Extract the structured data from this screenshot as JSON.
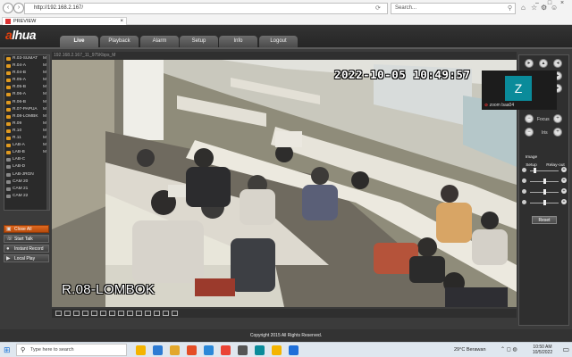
{
  "browser": {
    "address": "http://192.168.2.167/",
    "search_placeholder": "Search...",
    "tab_title": "PREVIEW",
    "tab_close": "×",
    "back_glyph": "‹",
    "forward_glyph": "›",
    "window_controls": [
      "–",
      "□",
      "×"
    ],
    "toolbar_icons": [
      "home-icon",
      "star-icon",
      "gear-icon",
      "smiley-icon"
    ]
  },
  "app": {
    "logo_prefix": "a",
    "logo_rest": "lhua",
    "nav": [
      {
        "label": "Live",
        "active": true
      },
      {
        "label": "Playback",
        "active": false
      },
      {
        "label": "Alarm",
        "active": false
      },
      {
        "label": "Setup",
        "active": false
      },
      {
        "label": "Info",
        "active": false
      },
      {
        "label": "Logout",
        "active": false
      }
    ],
    "copyright": "Copyright 2015 All Rights Reserved."
  },
  "channels": [
    {
      "label": "R.03-SUMAT",
      "m": "M",
      "active": true
    },
    {
      "label": "R.04-A",
      "m": "M",
      "active": true
    },
    {
      "label": "R.04-B",
      "m": "M",
      "active": true
    },
    {
      "label": "R.05-A",
      "m": "M",
      "active": true
    },
    {
      "label": "R.05-B",
      "m": "M",
      "active": true
    },
    {
      "label": "R.06-A",
      "m": "M",
      "active": true
    },
    {
      "label": "R.06-B",
      "m": "M",
      "active": true
    },
    {
      "label": "R.07-PAPUA",
      "m": "M",
      "active": true
    },
    {
      "label": "R.08-LOMBK",
      "m": "M",
      "active": true
    },
    {
      "label": "R.09",
      "m": "M",
      "active": true
    },
    {
      "label": "R.10",
      "m": "M",
      "active": true
    },
    {
      "label": "R.11",
      "m": "M",
      "active": true
    },
    {
      "label": "LAB-A",
      "m": "M",
      "active": true
    },
    {
      "label": "LAB-B",
      "m": "M",
      "active": true
    },
    {
      "label": "LAB-C",
      "m": "",
      "active": false
    },
    {
      "label": "LAB-D",
      "m": "",
      "active": false
    },
    {
      "label": "LAB-JRGN",
      "m": "",
      "active": false
    },
    {
      "label": "CAM 20",
      "m": "",
      "active": false
    },
    {
      "label": "CAM 21",
      "m": "",
      "active": false
    },
    {
      "label": "CAM 22",
      "m": "",
      "active": false
    }
  ],
  "side_buttons": {
    "close_all": "Close All",
    "start_talk": "Start Talk",
    "instant_record": "Instant Record",
    "local_play": "Local Play"
  },
  "video": {
    "info_bar": "192.168.2.167_11_975Kbps_M",
    "osd_time": "2022-10-05 10:49:57",
    "osd_name": "R.08-LOMBOK"
  },
  "ptz": {
    "focus_label": "Focus",
    "iris_label": "Iris",
    "image_setup_label": "Image Setup",
    "relay_out_label": "Relay-out",
    "reset_label": "Reset"
  },
  "zoom_overlay": {
    "avatar_letter": "Z",
    "name": "zoom baa04"
  },
  "taskbar": {
    "search_placeholder": "Type here to search",
    "weather": "29°C  Berawan",
    "time": "10:50 AM",
    "date": "10/5/2022",
    "app_colors": [
      "#f4b400",
      "#2d7bd3",
      "#e2a72b",
      "#e44d26",
      "#2b88d8",
      "#ea4335",
      "#555555",
      "#0a8b9a",
      "#f4b400",
      "#1e6fd9"
    ]
  },
  "colors": {
    "brand_orange": "#e8400c",
    "channel_icon": "#e09a20"
  }
}
